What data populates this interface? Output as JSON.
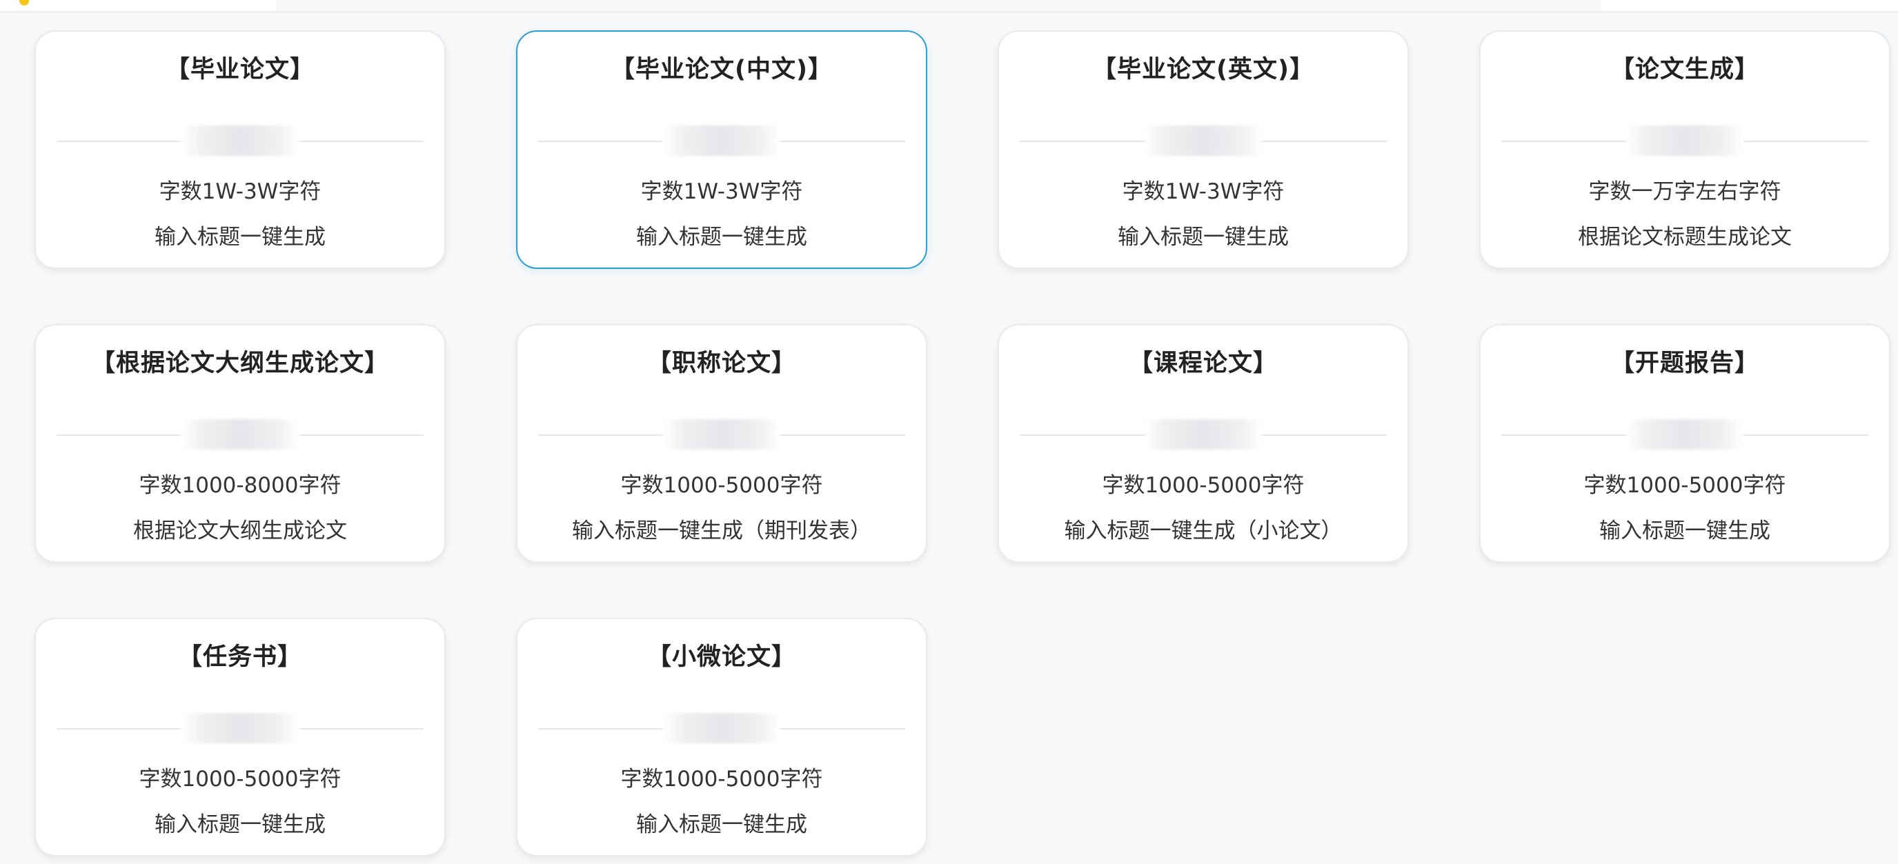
{
  "cards": [
    {
      "title": "【毕业论文】",
      "price": "",
      "line1": "字数1W-3W字符",
      "line2": "输入标题一键生成"
    },
    {
      "title": "【毕业论文(中文)】",
      "price": "",
      "line1": "字数1W-3W字符",
      "line2": "输入标题一键生成"
    },
    {
      "title": "【毕业论文(英文)】",
      "price": "",
      "line1": "字数1W-3W字符",
      "line2": "输入标题一键生成"
    },
    {
      "title": "【论文生成】",
      "price": "",
      "line1": "字数一万字左右字符",
      "line2": "根据论文标题生成论文"
    },
    {
      "title": "【根据论文大纲生成论文】",
      "price": "",
      "line1": "字数1000-8000字符",
      "line2": "根据论文大纲生成论文"
    },
    {
      "title": "【职称论文】",
      "price": "",
      "line1": "字数1000-5000字符",
      "line2": "输入标题一键生成（期刊发表）"
    },
    {
      "title": "【课程论文】",
      "price": "",
      "line1": "字数1000-5000字符",
      "line2": "输入标题一键生成（小论文）"
    },
    {
      "title": "【开题报告】",
      "price": "",
      "line1": "字数1000-5000字符",
      "line2": "输入标题一键生成"
    },
    {
      "title": "【任务书】",
      "price": "",
      "line1": "字数1000-5000字符",
      "line2": "输入标题一键生成"
    },
    {
      "title": "【小微论文】",
      "price": "",
      "line1": "字数1000-5000字符",
      "line2": "输入标题一键生成"
    }
  ],
  "selected_index": 1,
  "colors": {
    "accent": "#2a9fd6",
    "card_border": "#e7eaee",
    "background": "#f7f8fa"
  }
}
